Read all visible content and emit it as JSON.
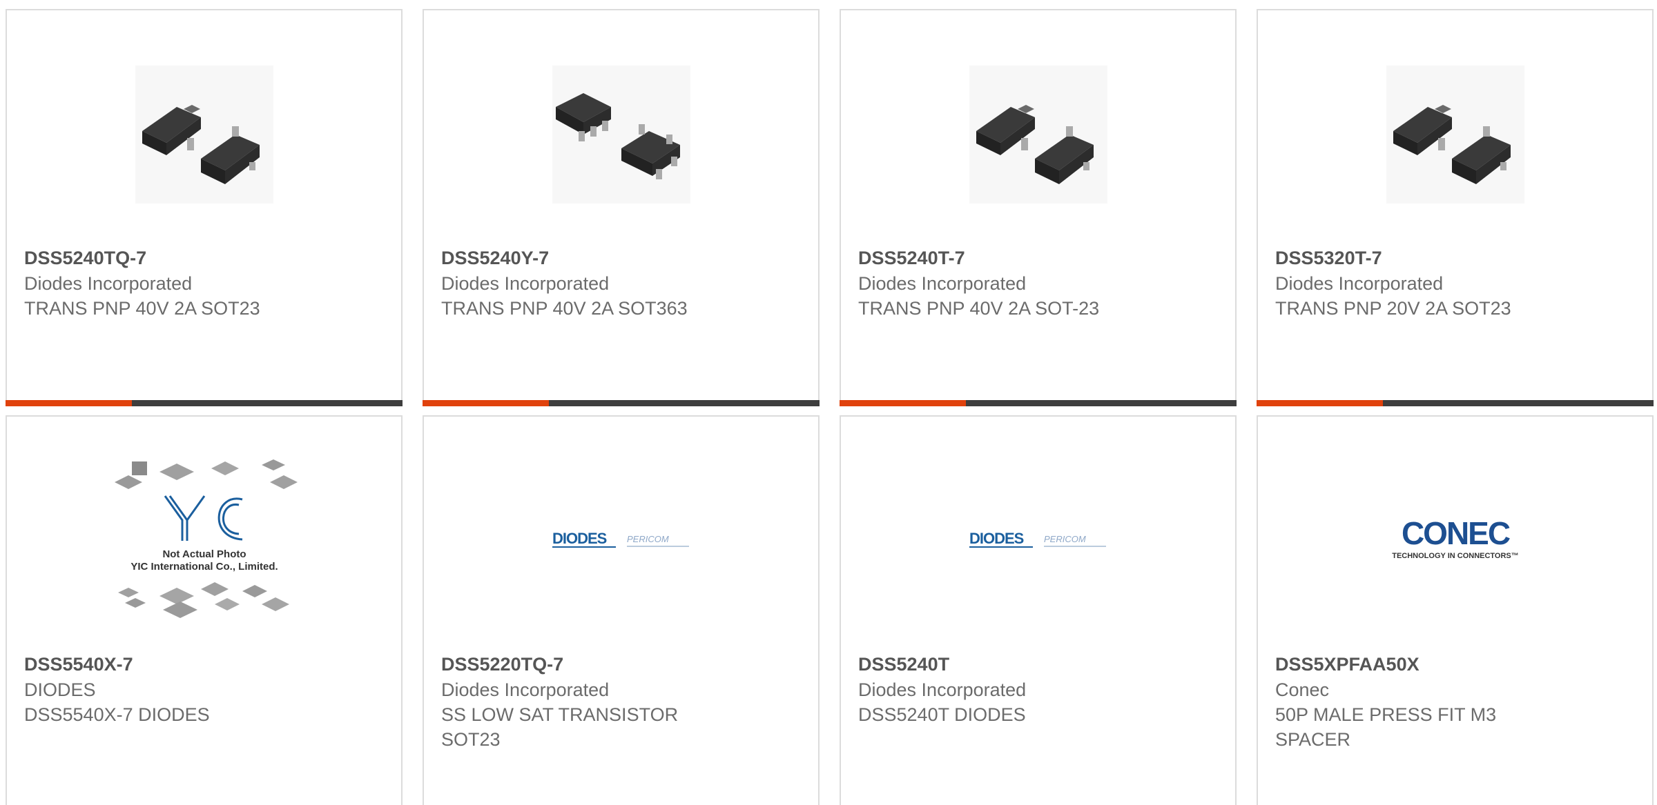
{
  "colors": {
    "accent": "#e0420d",
    "bar": "#3e3e3e",
    "border": "#dcdcdc",
    "diodes_blue": "#1b5f9e",
    "conec_blue": "#1d4f91"
  },
  "products": [
    {
      "part_number": "DSS5240TQ-7",
      "manufacturer": "Diodes Incorporated",
      "description": "TRANS PNP 40V 2A SOT23",
      "image": "sot23-package-icon"
    },
    {
      "part_number": "DSS5240Y-7",
      "manufacturer": "Diodes Incorporated",
      "description": "TRANS PNP 40V 2A SOT363",
      "image": "sot363-package-icon"
    },
    {
      "part_number": "DSS5240T-7",
      "manufacturer": "Diodes Incorporated",
      "description": "TRANS PNP 40V 2A SOT-23",
      "image": "sot23-package-icon"
    },
    {
      "part_number": "DSS5320T-7",
      "manufacturer": "Diodes Incorporated",
      "description": "TRANS PNP 20V 2A SOT23",
      "image": "sot23-package-icon"
    },
    {
      "part_number": "DSS5540X-7",
      "manufacturer": "DIODES",
      "description": "DSS5540X-7 DIODES",
      "image": "yic-placeholder-image",
      "image_text": [
        "Not Actual Photo",
        "YIC International Co., Limited."
      ]
    },
    {
      "part_number": "DSS5220TQ-7",
      "manufacturer": "Diodes Incorporated",
      "description": "SS LOW SAT TRANSISTOR SOT23",
      "image": "diodes-pericom-logo",
      "image_text": [
        "DIODES",
        "PERICOM"
      ]
    },
    {
      "part_number": "DSS5240T",
      "manufacturer": "Diodes Incorporated",
      "description": "DSS5240T DIODES",
      "image": "diodes-pericom-logo",
      "image_text": [
        "DIODES",
        "PERICOM"
      ]
    },
    {
      "part_number": "DSS5XPFAA50X",
      "manufacturer": "Conec",
      "description": "50P MALE PRESS FIT M3 SPACER",
      "image": "conec-logo",
      "image_text": [
        "CONEC",
        "TECHNOLOGY IN CONNECTORS™"
      ]
    }
  ]
}
